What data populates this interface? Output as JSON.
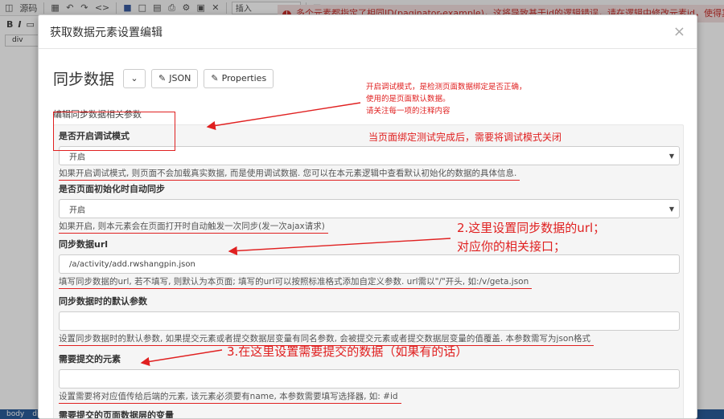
{
  "editor": {
    "toolbar": {
      "source_label": "源码",
      "insert_select": "插入",
      "format_bold": "B",
      "format_italic": "I"
    },
    "tag_input": "div",
    "error_message": "多个元素都指定了相同ID(paginator-example)，这将导致基于id的逻辑错误，请在逻辑中修改元素id，使得其名称不重复。",
    "status_items": [
      "body",
      "div"
    ]
  },
  "modal": {
    "title": "获取数据元素设置编辑",
    "close": "×",
    "section_title": "同步数据",
    "json_button": "JSON",
    "properties_button": "Properties",
    "subtitle": "编辑同步数据相关参数",
    "fields": [
      {
        "label": "是否开启调试模式",
        "value": "开启",
        "type": "select",
        "help": "如果开启调试模式, 则页面不会加载真实数据, 而是使用调试数据. 您可以在本元素逻辑中查看默认初始化的数据的具体信息."
      },
      {
        "label": "是否页面初始化时自动同步",
        "value": "开启",
        "type": "select",
        "help": "如果开启, 则本元素会在页面打开时自动触发一次同步(发一次ajax请求)"
      },
      {
        "label": "同步数据url",
        "value": "/a/activity/add.rwshangpin.json",
        "type": "input",
        "help": "填写同步数据的url, 若不填写, 则默认为本页面; 填写的url可以按照标准格式添加自定义参数. url需以\"/\"开头, 如:/v/geta.json"
      },
      {
        "label": "同步数据时的默认参数",
        "value": "",
        "type": "input",
        "help": "设置同步数据时的默认参数, 如果提交元素或者提交数据层变量有同名参数, 会被提交元素或者提交数据层变量的值覆盖. 本参数需写为json格式"
      },
      {
        "label": "需要提交的元素",
        "value": "",
        "type": "input",
        "help": "设置需要将对应值传给后端的元素, 该元素必须要有name, 本参数需要填写选择器, 如: #id"
      },
      {
        "label": "需要提交的页面数据层的变量",
        "value": "",
        "type": "input",
        "help": ""
      }
    ]
  },
  "annotations": {
    "debug_note_lines": [
      "开启调试模式，是检测页面数据绑定是否正确，",
      "使用的是页面默认数据。",
      "请关注每一项的注释内容"
    ],
    "debug_close_note": "当页面绑定测试完成后，需要将调试模式关闭",
    "url_note_lines": [
      "2.这里设置同步数据的url；",
      "对应你的相关接口；"
    ],
    "submit_note": "3.在这里设置需要提交的数据（如果有的话）",
    "color": "#e02020"
  }
}
